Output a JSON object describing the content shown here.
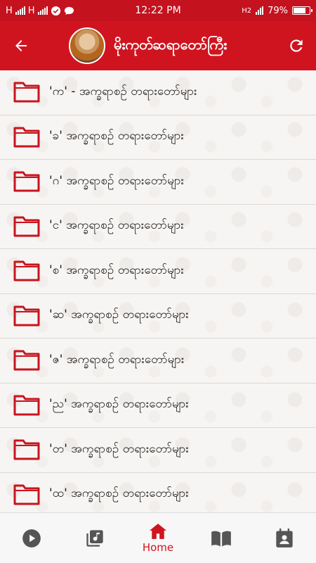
{
  "status_bar": {
    "network_left": "H",
    "network_right": "H",
    "time": "12:22 PM",
    "network_type": "H2",
    "battery": "79%",
    "battery_level": 0.79
  },
  "app_bar": {
    "title": "မိုးကုတ်ဆရာတော်ကြီး",
    "back_icon": "arrow-left-icon",
    "refresh_icon": "refresh-icon"
  },
  "list": {
    "items": [
      {
        "label": "'က' - အက္ခရာစဉ် တရားတော်များ"
      },
      {
        "label": "'ခ' အက္ခရာစဉ် တရားတော်များ"
      },
      {
        "label": "'ဂ' အက္ခရာစဉ် တရားတော်များ"
      },
      {
        "label": "'င' အက္ခရာစဉ် တရားတော်များ"
      },
      {
        "label": "'စ' အက္ခရာစဉ် တရားတော်များ"
      },
      {
        "label": "'ဆ' အက္ခရာစဉ် တရားတော်များ"
      },
      {
        "label": "'ဇ' အက္ခရာစဉ် တရားတော်များ"
      },
      {
        "label": "'ည' အက္ခရာစဉ် တရားတော်များ"
      },
      {
        "label": "'တ' အက္ခရာစဉ် တရားတော်များ"
      },
      {
        "label": "'ထ' အက္ခရာစဉ် တရားတော်များ"
      }
    ]
  },
  "bottom_nav": {
    "items": [
      {
        "icon": "play-icon",
        "label": ""
      },
      {
        "icon": "music-library-icon",
        "label": ""
      },
      {
        "icon": "home-icon",
        "label": "Home"
      },
      {
        "icon": "book-icon",
        "label": ""
      },
      {
        "icon": "calendar-person-icon",
        "label": ""
      }
    ]
  },
  "colors": {
    "primary": "#d0141f",
    "folder": "#c8141f"
  }
}
